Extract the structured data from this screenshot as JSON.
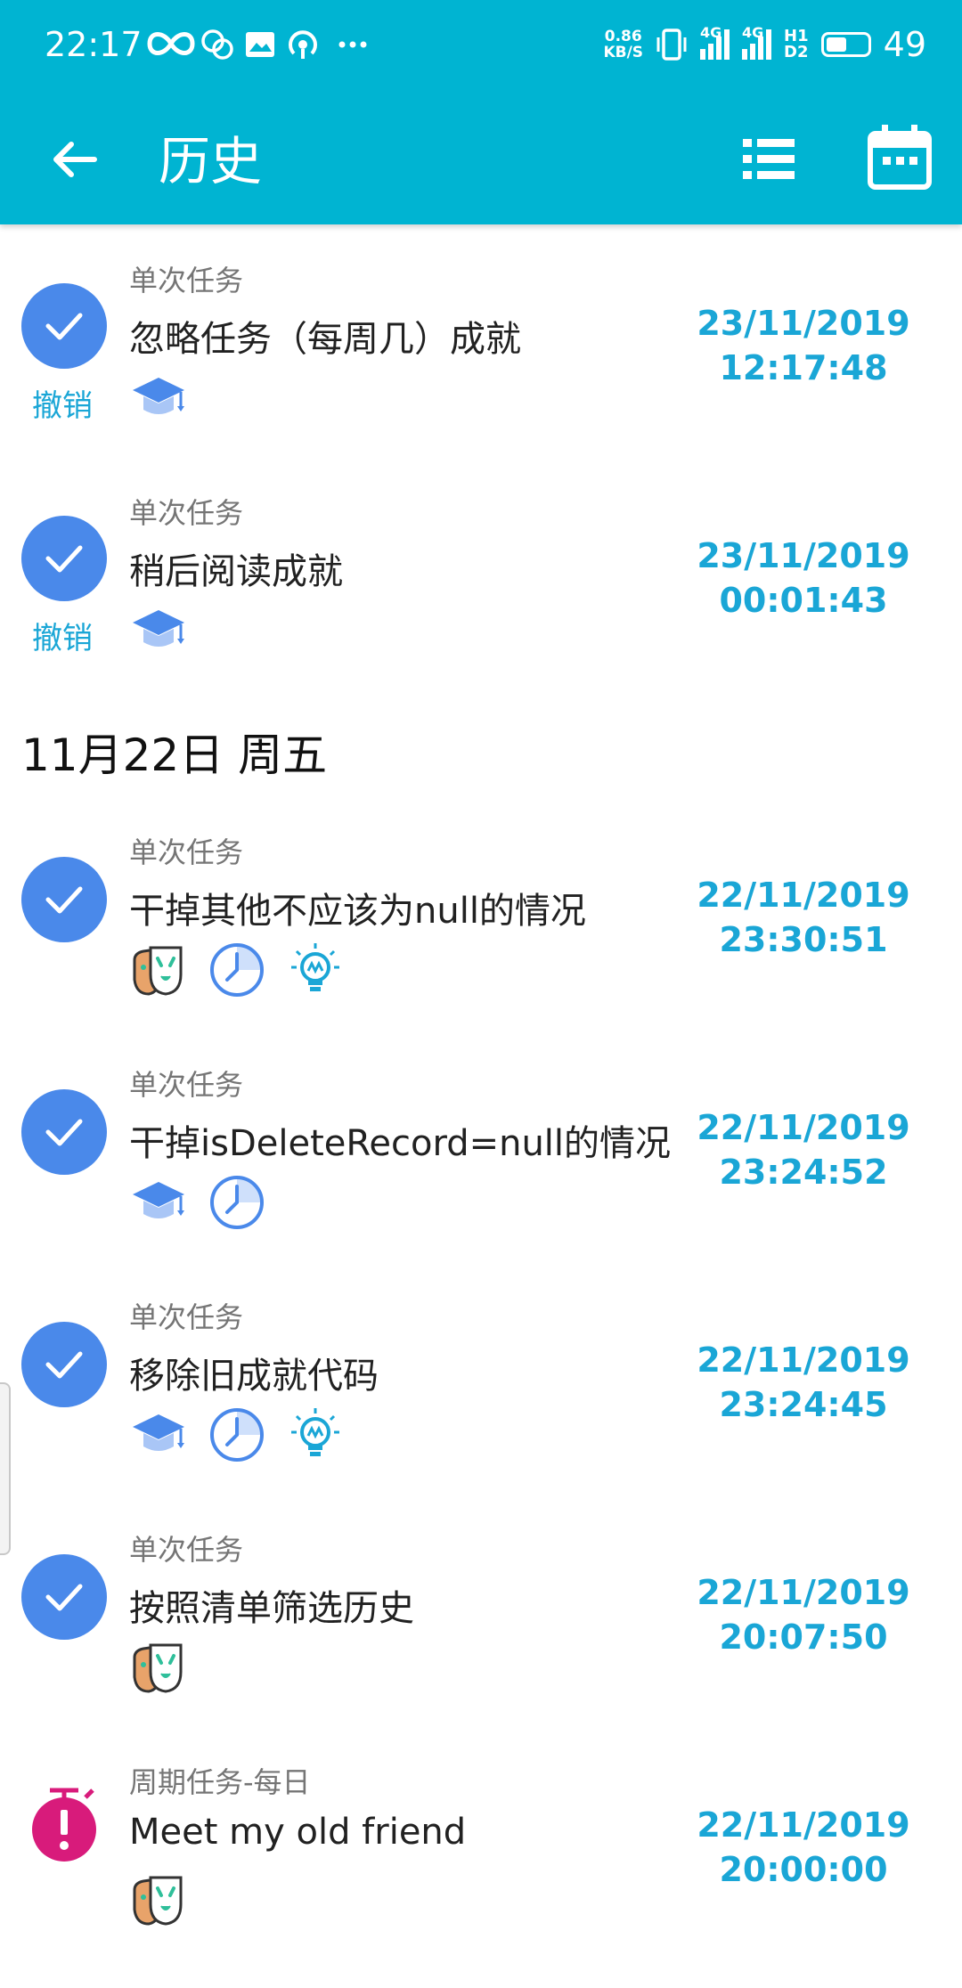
{
  "status_bar": {
    "time": "22:17",
    "net_speed_value": "0.86",
    "net_speed_unit": "KB/S",
    "sim1": "4G",
    "sim2": "4G",
    "hd": "H1",
    "hd2": "D2",
    "battery": "49"
  },
  "app_bar": {
    "title": "历史",
    "icons": [
      "back-arrow-icon",
      "list-icon",
      "calendar-icon"
    ]
  },
  "colors": {
    "accent": "#00b4d2",
    "check": "#4a89ea",
    "link": "#1aa6d6",
    "alarm": "#d81b7b"
  },
  "undo_label": "撤销",
  "section_header": "11月22日 周五",
  "items": [
    {
      "type": "单次任务",
      "name": "忽略任务（每周几）成就",
      "date": "23/11/2019",
      "time": "12:17:48",
      "undo": true,
      "icons": [
        "graduation-cap-icon"
      ]
    },
    {
      "type": "单次任务",
      "name": "稍后阅读成就",
      "date": "23/11/2019",
      "time": "00:01:43",
      "undo": true,
      "icons": [
        "graduation-cap-icon"
      ]
    },
    {
      "type": "单次任务",
      "name": "干掉其他不应该为null的情况",
      "date": "22/11/2019",
      "time": "23:30:51",
      "undo": false,
      "icons": [
        "masks-icon",
        "clock-icon",
        "lightbulb-icon"
      ]
    },
    {
      "type": "单次任务",
      "name": "干掉isDeleteRecord=null的情况",
      "date": "22/11/2019",
      "time": "23:24:52",
      "undo": false,
      "icons": [
        "graduation-cap-icon",
        "clock-icon"
      ]
    },
    {
      "type": "单次任务",
      "name": "移除旧成就代码",
      "date": "22/11/2019",
      "time": "23:24:45",
      "undo": false,
      "icons": [
        "graduation-cap-icon",
        "clock-icon",
        "lightbulb-icon"
      ]
    },
    {
      "type": "单次任务",
      "name": "按照清单筛选历史",
      "date": "22/11/2019",
      "time": "20:07:50",
      "undo": false,
      "icons": [
        "masks-icon"
      ]
    },
    {
      "type": "周期任务-每日",
      "name": "Meet my old friend",
      "date": "22/11/2019",
      "time": "20:00:00",
      "undo": false,
      "status": "alarm",
      "icons": [
        "masks-icon"
      ]
    }
  ]
}
